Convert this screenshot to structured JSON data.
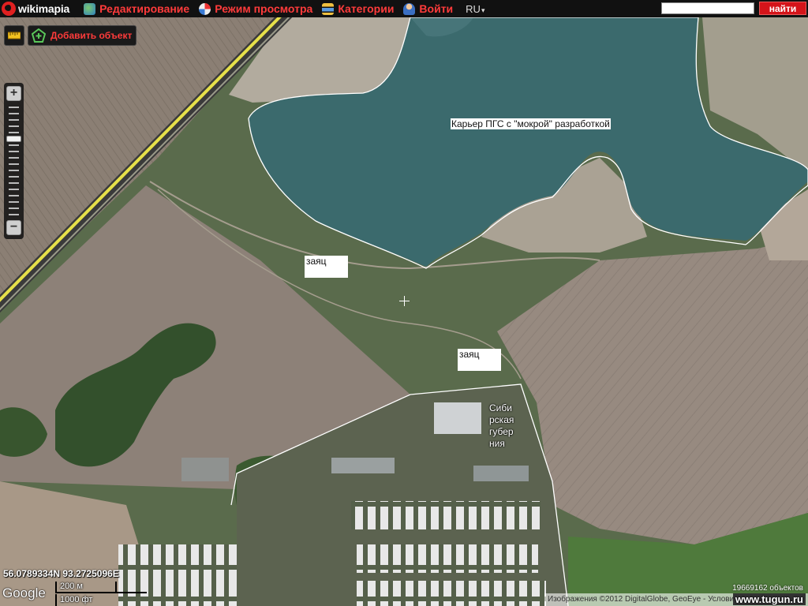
{
  "header": {
    "logo_text": "wikimapia",
    "menu": [
      {
        "label": "Редактирование",
        "icon": "globe-edit-icon"
      },
      {
        "label": "Режим просмотра",
        "icon": "compass-icon"
      },
      {
        "label": "Категории",
        "icon": "categories-icon"
      },
      {
        "label": "Войти",
        "icon": "user-icon"
      }
    ],
    "language": "RU",
    "search_value": "",
    "search_button": "найти"
  },
  "toolbar": {
    "ruler_icon": "ruler-icon",
    "add_object_label": "Добавить объект",
    "add_object_icon": "add-object-icon"
  },
  "zoom": {
    "zoom_in": "+",
    "zoom_out": "−",
    "level_fraction": 0.3
  },
  "map": {
    "labels": {
      "quarry": "Карьер ПГС с \"мокрой\" разработкой",
      "hare_1": "заяц",
      "hare_2": "заяц",
      "gubernia": "Сибирская губерния"
    },
    "coordinates": "56.0789334N 93.2725096E",
    "scale_metric": "200 м",
    "scale_imperial": "1000 фт",
    "google_logo": "Google",
    "object_count": "19669162 объектов",
    "attribution": "Изображения ©2012 DigitalGlobe, GeoEye - Условия использования",
    "watermark": "www.tugun.ru",
    "colors": {
      "water": "#3c6a6e",
      "field": "#8a7d73",
      "field_light": "#9a8f86",
      "forest": "#3f5a34",
      "grass": "#56664a",
      "road": "#e8e04a",
      "boundary": "#ffffff",
      "accent_red": "#ff3b3b"
    }
  }
}
